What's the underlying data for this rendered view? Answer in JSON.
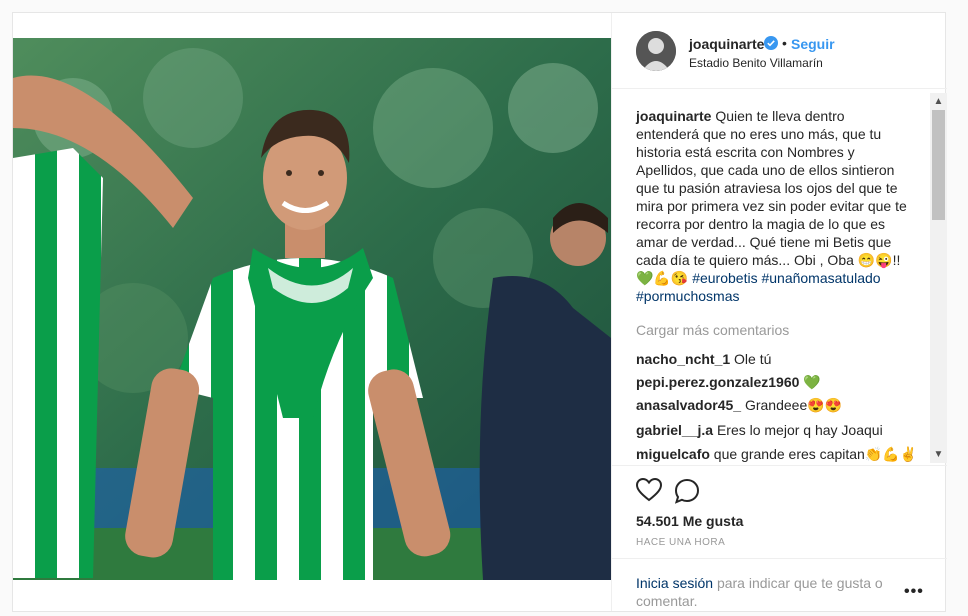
{
  "header": {
    "username": "joaquinarte",
    "dot": "•",
    "follow_label": "Seguir",
    "location": "Estadio Benito Villamarín"
  },
  "caption": {
    "username": "joaquinarte",
    "text": "Quien te lleva dentro entenderá que no eres uno más, que tu historia está escrita con Nombres y Apellidos, que cada uno de ellos sintieron que tu pasión atraviesa los ojos del que te mira por primera vez sin poder evitar que te recorra por dentro la magia de lo que es amar de verdad... Qué tiene mi Betis que cada día te quiero más... Obi , Oba",
    "emoji1": "😁😜!!",
    "emoji2": "💚💪😘",
    "hashtags": [
      "#eurobetis",
      "#unañomasatulado",
      "#pormuchosmas"
    ]
  },
  "load_more_label": "Cargar más comentarios",
  "comments": [
    {
      "user": "nacho_ncht_1",
      "text": "Ole tú"
    },
    {
      "user": "pepi.perez.gonzalez1960",
      "text": "💚"
    },
    {
      "user": "anasalvador45_",
      "text": "Grandeee😍😍"
    },
    {
      "user": "gabriel__j.a",
      "text": "Eres lo mejor q hay Joaqui"
    },
    {
      "user": "miguelcafo",
      "text": "que grande eres capitan👏💪✌"
    }
  ],
  "likes": "54.501 Me gusta",
  "timestamp": "HACE UNA HORA",
  "login": {
    "link": "Inicia sesión",
    "text": "para indicar que te gusta o comentar."
  },
  "more_label": "•••",
  "colors": {
    "accent": "#3897f0",
    "link": "#003569",
    "muted": "#999999",
    "betis_green": "#0a9e4a"
  },
  "icons": [
    "verified-icon",
    "heart-icon",
    "comment-icon",
    "more-icon",
    "scroll-up-icon",
    "scroll-down-icon"
  ]
}
